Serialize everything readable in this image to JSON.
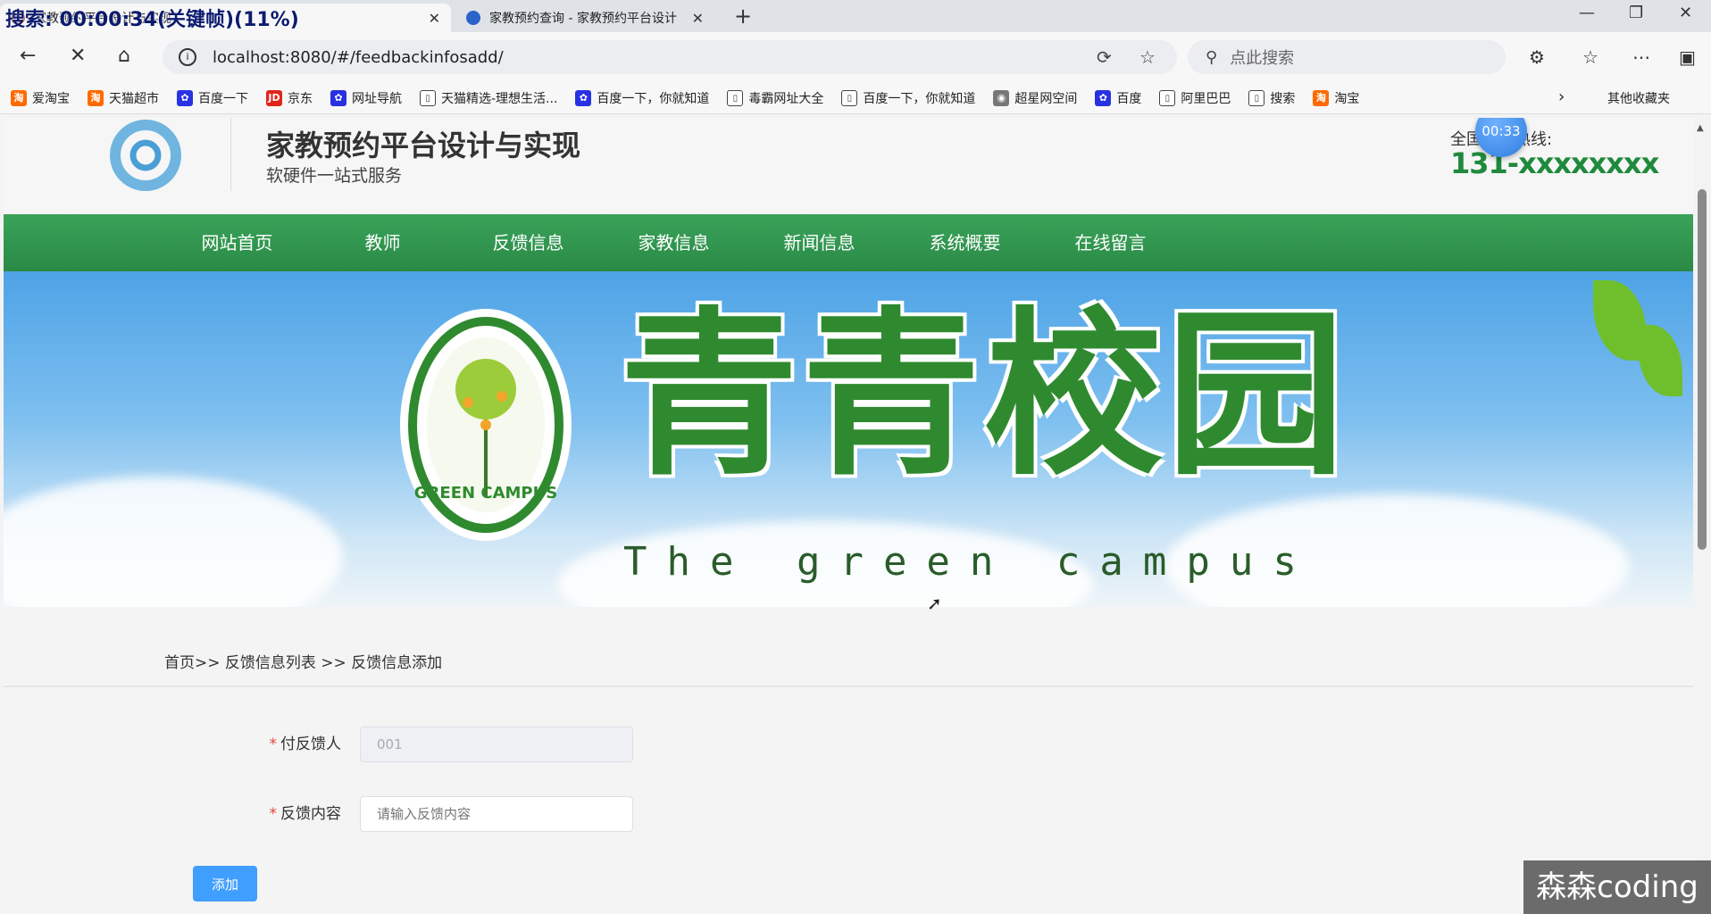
{
  "browser": {
    "recording_overlay": "搜索: 00:00:34(关键帧)(11%)",
    "tabs": [
      {
        "title": "家教预约平台设计与实现",
        "favicon_color": "#c0392b"
      },
      {
        "title": "家教预约查询 - 家教预约平台设计",
        "favicon_color": "#2a63c9"
      }
    ],
    "url": "localhost:8080/#/feedbackinfosadd/",
    "search_placeholder": "点此搜索",
    "bookmarks": [
      {
        "label": "爱淘宝",
        "icon": "taobao-icon",
        "color": "#ff6a00",
        "glyph": "淘"
      },
      {
        "label": "天猫超市",
        "icon": "taobao-icon",
        "color": "#ff6a00",
        "glyph": "淘"
      },
      {
        "label": "百度一下",
        "icon": "baidu-icon",
        "color": "#2932e1",
        "glyph": "✿"
      },
      {
        "label": "京东",
        "icon": "jd-icon",
        "color": "#e1251b",
        "glyph": "JD"
      },
      {
        "label": "网址导航",
        "icon": "baidu-icon",
        "color": "#2932e1",
        "glyph": "✿"
      },
      {
        "label": "天猫精选-理想生活...",
        "icon": "page-icon",
        "color": "#ffffff",
        "glyph": "▯"
      },
      {
        "label": "百度一下，你就知道",
        "icon": "baidu-icon",
        "color": "#2932e1",
        "glyph": "✿"
      },
      {
        "label": "毒霸网址大全",
        "icon": "page-icon",
        "color": "#ffffff",
        "glyph": "▯"
      },
      {
        "label": "百度一下，你就知道",
        "icon": "page-icon",
        "color": "#ffffff",
        "glyph": "▯"
      },
      {
        "label": "超星网空间",
        "icon": "globe-icon",
        "color": "#777777",
        "glyph": "◉"
      },
      {
        "label": "百度",
        "icon": "baidu-icon",
        "color": "#2932e1",
        "glyph": "✿"
      },
      {
        "label": "阿里巴巴",
        "icon": "page-icon",
        "color": "#ffffff",
        "glyph": "▯"
      },
      {
        "label": "搜索",
        "icon": "page-icon",
        "color": "#ffffff",
        "glyph": "▯"
      },
      {
        "label": "淘宝",
        "icon": "taobao-icon",
        "color": "#ff6a00",
        "glyph": "淘"
      }
    ],
    "other_bookmarks": "其他收藏夹"
  },
  "site": {
    "title": "家教预约平台设计与实现",
    "subtitle": "软硬件一站式服务",
    "hotline_label": "全国服务热线:",
    "hotline_number": "131-xxxxxxxx",
    "timer": "00:33",
    "nav": [
      "网站首页",
      "教师",
      "反馈信息",
      "家教信息",
      "新闻信息",
      "系统概要",
      "在线留言"
    ],
    "accent": "#2f9a4f"
  },
  "banner": {
    "title_cn": "青青校园",
    "title_en": "The green campus",
    "badge_text": "GREEN CAMPUS"
  },
  "breadcrumb": "首页>> 反馈信息列表 >> 反馈信息添加",
  "form": {
    "fields": [
      {
        "label": "付反馈人",
        "value": "001",
        "placeholder": "",
        "disabled": true
      },
      {
        "label": "反馈内容",
        "value": "",
        "placeholder": "请输入反馈内容",
        "disabled": false
      }
    ],
    "submit_label": "添加",
    "required_mark": "*"
  },
  "watermark": "森森coding"
}
